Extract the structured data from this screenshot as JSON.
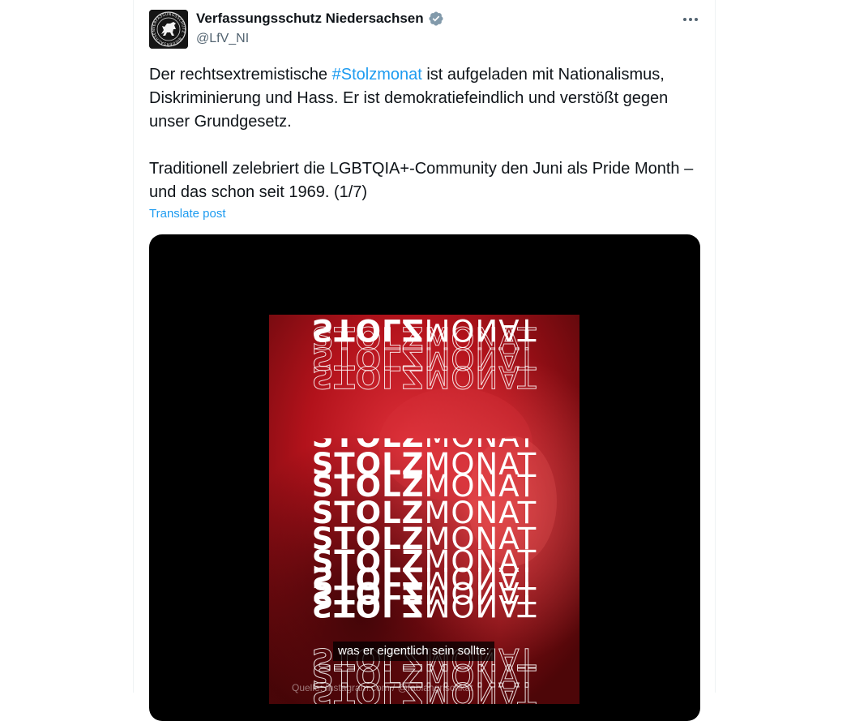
{
  "author": {
    "display_name": "Verfassungsschutz Niedersachsen",
    "handle": "@LfV_NI",
    "verified_color": "#829aab",
    "avatar_ring_text": "VERFASSUNGSSCHUTZ · NIEDERSACHSEN ·"
  },
  "tweet": {
    "para1_before": "Der rechtsextremistische ",
    "hashtag": "#Stolzmonat",
    "para1_after": " ist aufgeladen mit Nationalismus, Diskriminierung und Hass. Er ist demokratiefeindlich und verstößt gegen unser Grundgesetz.",
    "para2": "Traditionell zelebriert die LGBTQIA+-Community den Juni als Pride Month – und das schon seit 1969. (1/7)",
    "translate_label": "Translate post"
  },
  "media": {
    "bold_word": "STOLZ",
    "thin_word": "MONAT",
    "subtitle": "was er eigentlich sein sollte:",
    "credit": "Quelle: Instagram.com / @fabiangrischkat"
  },
  "colors": {
    "link": "#1d9bf0",
    "text": "#0f1419",
    "muted": "#536471",
    "video_red": "#c8161f"
  },
  "icons": [
    "verified-badge-icon",
    "more-options-icon",
    "coat-of-arms-horse-icon"
  ]
}
